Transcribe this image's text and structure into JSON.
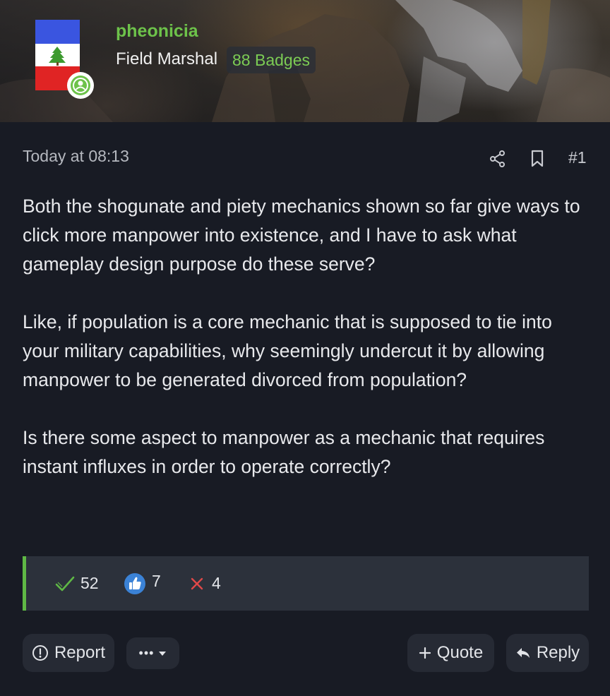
{
  "user": {
    "username": "pheonicia",
    "title": "Field Marshal",
    "badges": "88 Badges"
  },
  "post": {
    "date": "Today at 08:13",
    "number": "#1",
    "paragraphs": [
      "Both the shogunate and piety mechanics shown so far give ways to click more manpower into existence, and I have to ask what gameplay design purpose do these serve?",
      "Like, if population is a core mechanic that is supposed to tie into your military capabilities, why seemingly undercut it by allowing manpower to be generated divorced from population?",
      "Is there some aspect to manpower as a mechanic that requires instant influxes in order to operate correctly?"
    ]
  },
  "reactions": [
    {
      "icon": "checkmark-icon",
      "count": "52",
      "color": "#5fb845"
    },
    {
      "icon": "thumbs-up-icon",
      "count": "7",
      "color": "#3b82d6"
    },
    {
      "icon": "x-icon",
      "count": "4",
      "color": "#e04848"
    }
  ],
  "actions": {
    "report": "Report",
    "more": "•••",
    "quote": "Quote",
    "reply": "Reply"
  },
  "colors": {
    "accent": "#6dc24a",
    "background": "#181b24",
    "reaction_bar": "#2c313b"
  }
}
